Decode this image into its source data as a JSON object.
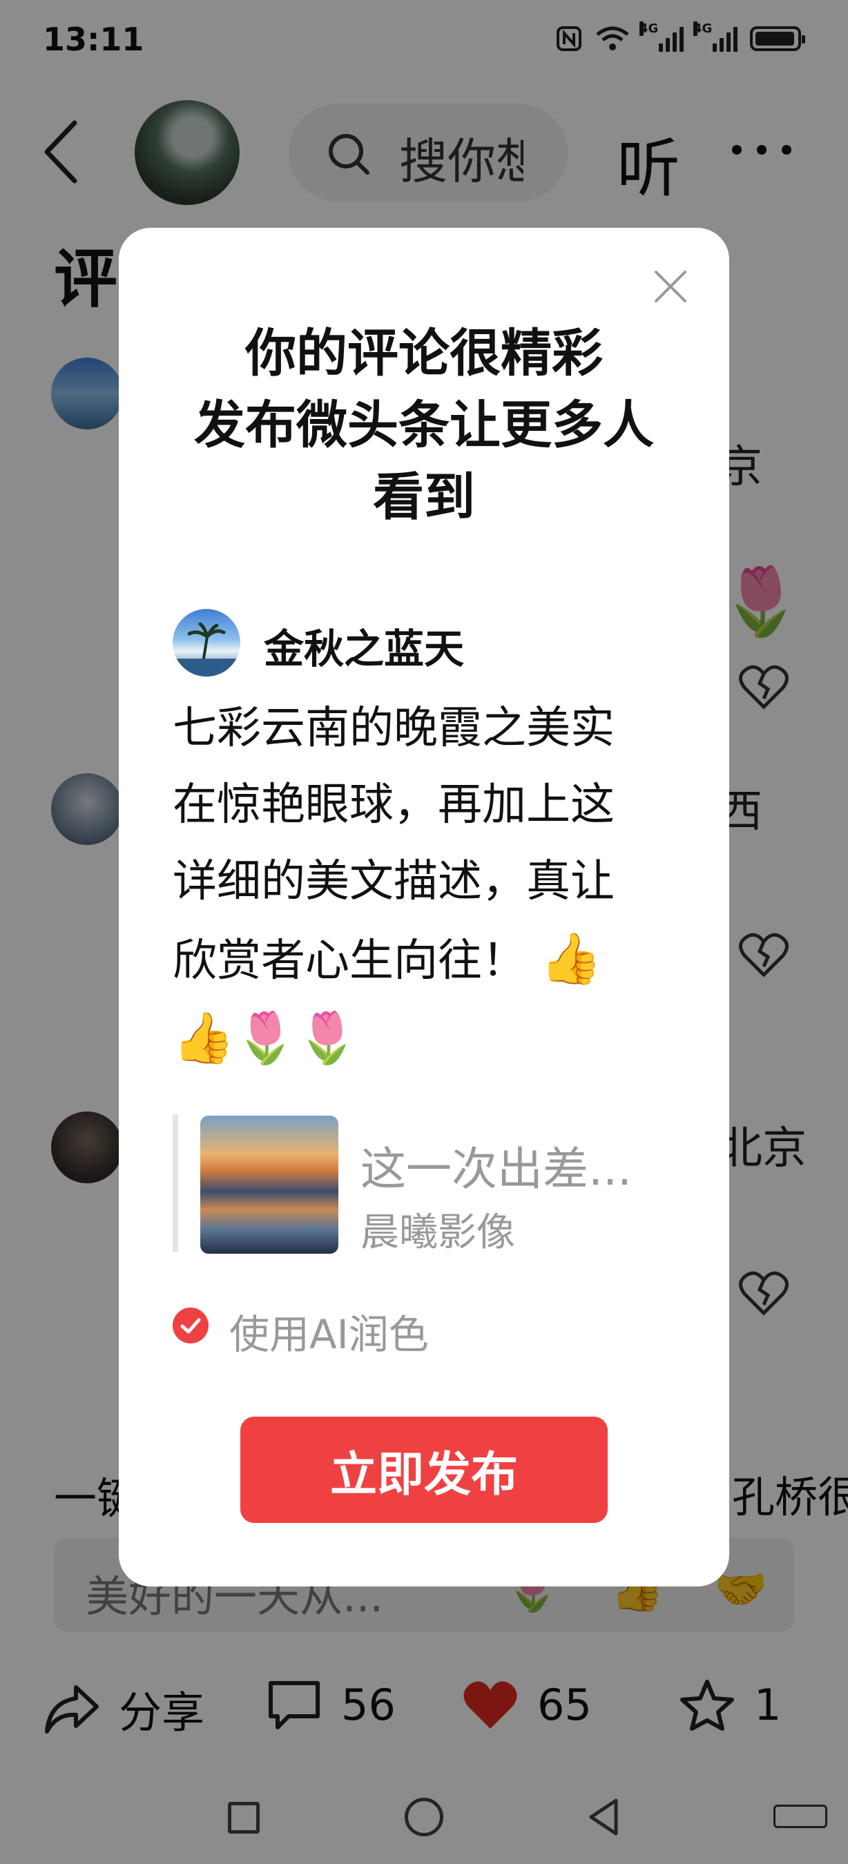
{
  "status_bar": {
    "time": "13:11",
    "network_1": "4G",
    "network_2": "4G"
  },
  "header": {
    "search_placeholder": "搜你想",
    "listen_label": "听"
  },
  "background": {
    "section_title": "评论",
    "comment_1_suffix": "京",
    "comment_2_suffix": "西",
    "comment_3_suffix": "北京",
    "bottom_left": "一键",
    "bottom_right": "孔桥很",
    "input_placeholder": "美好的一天从...",
    "input_emojis": [
      "🌷",
      "👍",
      "🤝"
    ]
  },
  "actions": {
    "share_label": "分享",
    "comments_count": "56",
    "likes_count": "65",
    "favorites_count": "1"
  },
  "modal": {
    "title_lines": [
      "你的评论很精彩",
      "发布微头条让更多人",
      "看到"
    ],
    "author_name": "金秋之蓝天",
    "comment_lines": [
      "七彩云南的晚霞之美实",
      "在惊艳眼球，再加上这",
      "详细的美文描述，真让",
      "欣赏者心生向往！"
    ],
    "comment_emojis_1": "👍",
    "comment_emojis_2": "👍🌷🌷",
    "quote_title": "这一次出差...",
    "quote_source": "晨曦影像",
    "ai_option_label": "使用AI润色",
    "ai_option_checked": true,
    "publish_label": "立即发布",
    "accent_color": "#f04142"
  }
}
